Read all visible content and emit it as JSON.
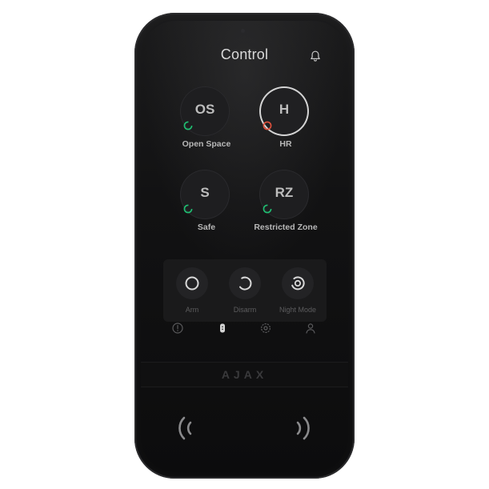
{
  "header": {
    "title": "Control"
  },
  "groups": [
    {
      "code": "OS",
      "label": "Open Space",
      "status": "disarmed",
      "status_color": "#1fbf72"
    },
    {
      "code": "H",
      "label": "HR",
      "status": "armed",
      "status_color": "#e0503c"
    },
    {
      "code": "S",
      "label": "Safe",
      "status": "disarmed",
      "status_color": "#1fbf72"
    },
    {
      "code": "RZ",
      "label": "Restricted Zone",
      "status": "disarmed",
      "status_color": "#1fbf72"
    }
  ],
  "modes": {
    "arm_label": "Arm",
    "disarm_label": "Disarm",
    "night_label": "Night Mode"
  },
  "nav": {
    "items": [
      "alert-icon",
      "keypad-icon",
      "settings-icon",
      "user-icon"
    ]
  },
  "brand": {
    "logo": "AJAX"
  },
  "icons": {
    "bell": "bell-icon",
    "nfc_left": "nfc-icon",
    "nfc_right": "nfc-icon"
  }
}
